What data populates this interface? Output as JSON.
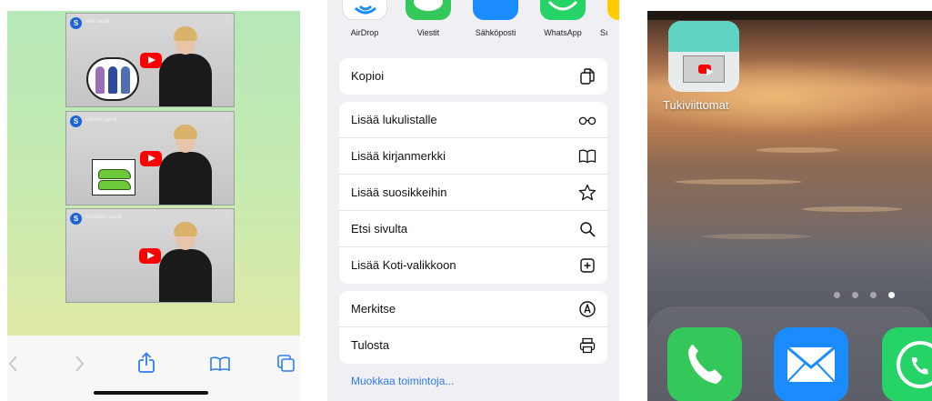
{
  "safari": {
    "videos": [
      {
        "avatar_letter": "S",
        "title": "Arki sanat"
      },
      {
        "avatar_letter": "S",
        "title": "Ulkoilu sanat"
      },
      {
        "avatar_letter": "S",
        "title": "Ruokailu sanat"
      }
    ],
    "toolbar": {
      "icons": [
        "back-chevron-icon",
        "forward-chevron-icon",
        "share-icon",
        "bookmarks-book-icon",
        "tabs-icon"
      ]
    }
  },
  "share_sheet": {
    "apps": [
      {
        "label": "AirDrop",
        "color": "#1a8cff"
      },
      {
        "label": "Viestit",
        "color": "#34c759"
      },
      {
        "label": "Sähköposti",
        "color": "#1a8cff"
      },
      {
        "label": "WhatsApp",
        "color": "#25d366"
      },
      {
        "label": "Sı",
        "color": "#ffcc00"
      }
    ],
    "group1": [
      {
        "label": "Kopioi",
        "icon": "copy-icon"
      }
    ],
    "group2": [
      {
        "label": "Lisää lukulistalle",
        "icon": "glasses-icon"
      },
      {
        "label": "Lisää kirjanmerkki",
        "icon": "book-icon"
      },
      {
        "label": "Lisää suosikkeihin",
        "icon": "star-icon"
      },
      {
        "label": "Etsi sivulta",
        "icon": "search-icon"
      },
      {
        "label": "Lisää Koti-valikkoon",
        "icon": "add-square-icon"
      }
    ],
    "group3": [
      {
        "label": "Merkitse",
        "icon": "markup-pen-icon"
      },
      {
        "label": "Tulosta",
        "icon": "printer-icon"
      }
    ],
    "edit_actions": "Muokkaa toimintoja..."
  },
  "home_screen": {
    "app_name": "Tukiviittomat",
    "page_dots": 4,
    "active_page": 4,
    "dock": [
      {
        "name": "phone-app-icon",
        "color": "#34c759"
      },
      {
        "name": "mail-app-icon",
        "color": "#1a8cff"
      },
      {
        "name": "whatsapp-app-icon",
        "color": "#25d366"
      }
    ]
  }
}
